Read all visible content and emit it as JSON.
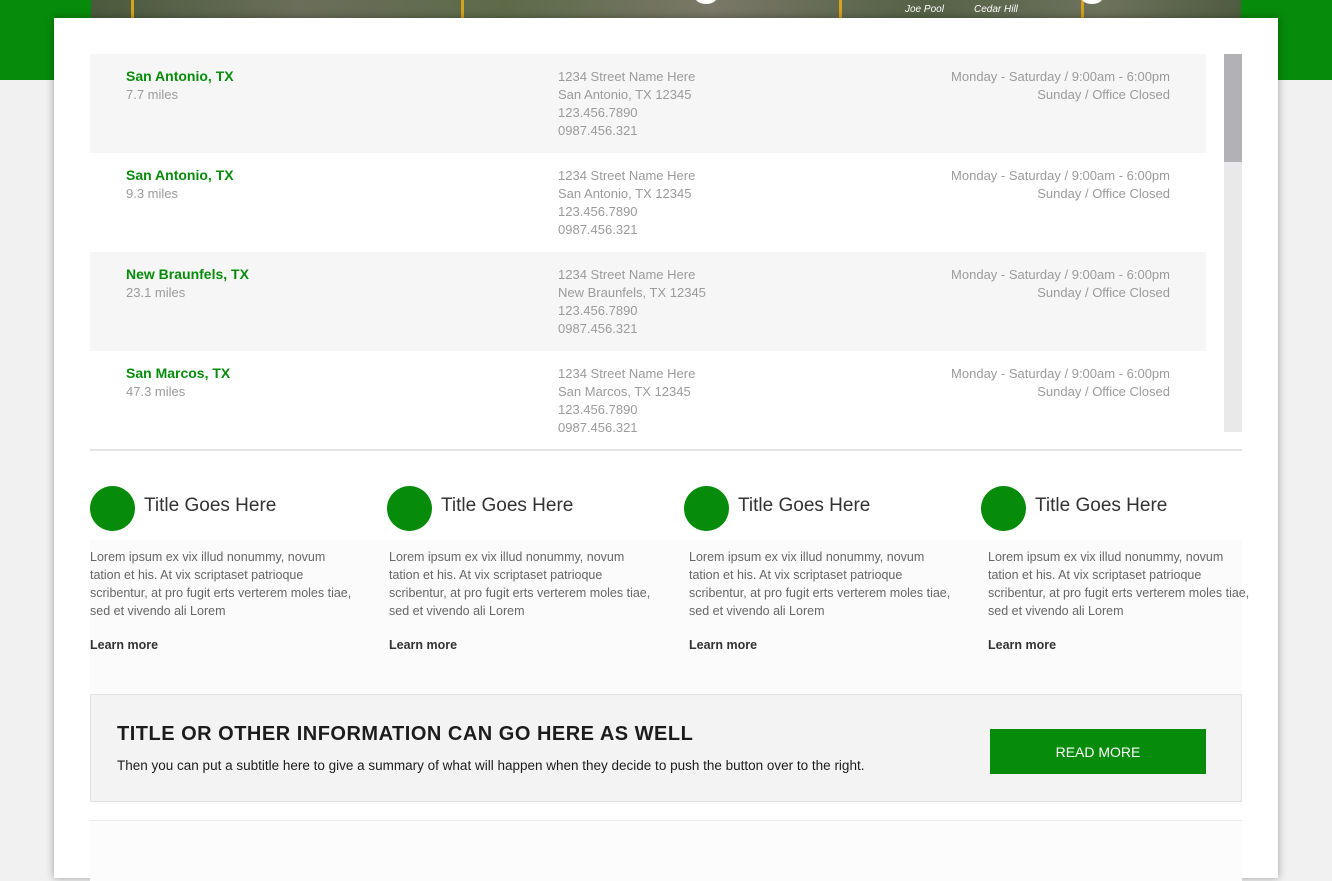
{
  "colors": {
    "brand_green": "#068c0a",
    "muted_text": "#9b9b9b",
    "dark_text": "#1c1c1c",
    "row_shade": "#f6f6f6"
  },
  "map": {
    "labels": [
      "Joe Pool",
      "Cedar Hill"
    ]
  },
  "locations": [
    {
      "city": "San Antonio, TX",
      "distance": "7.7 miles",
      "street": "1234 Street Name Here",
      "city_line": "San Antonio, TX 12345",
      "phone1": "123.456.7890",
      "phone2": "0987.456.321",
      "hours1": "Monday - Saturday / 9:00am - 6:00pm",
      "hours2": "Sunday / Office Closed"
    },
    {
      "city": "San Antonio, TX",
      "distance": "9.3 miles",
      "street": "1234 Street Name Here",
      "city_line": "San Antonio, TX 12345",
      "phone1": "123.456.7890",
      "phone2": "0987.456.321",
      "hours1": "Monday - Saturday / 9:00am - 6:00pm",
      "hours2": "Sunday / Office Closed"
    },
    {
      "city": "New Braunfels, TX",
      "distance": "23.1 miles",
      "street": "1234 Street Name Here",
      "city_line": "New Braunfels, TX 12345",
      "phone1": "123.456.7890",
      "phone2": "0987.456.321",
      "hours1": "Monday - Saturday / 9:00am - 6:00pm",
      "hours2": "Sunday / Office Closed"
    },
    {
      "city": "San Marcos, TX",
      "distance": "47.3 miles",
      "street": "1234 Street Name Here",
      "city_line": "San Marcos, TX 12345",
      "phone1": "123.456.7890",
      "phone2": "0987.456.321",
      "hours1": "Monday - Saturday / 9:00am - 6:00pm",
      "hours2": "Sunday / Office Closed"
    }
  ],
  "features": [
    {
      "title": "Title Goes Here",
      "text": "Lorem ipsum ex vix illud nonummy, novum tation et his. At vix scriptaset patrioque scribentur, at pro fugit erts verterem moles tiae, sed et vivendo ali Lorem",
      "link": "Learn more"
    },
    {
      "title": "Title Goes Here",
      "text": "Lorem ipsum ex vix illud nonummy, novum tation et his. At vix scriptaset patrioque scribentur, at pro fugit erts verterem moles tiae, sed et vivendo ali Lorem",
      "link": "Learn more"
    },
    {
      "title": "Title Goes Here",
      "text": "Lorem ipsum ex vix illud nonummy, novum tation et his. At vix scriptaset patrioque scribentur, at pro fugit erts verterem moles tiae, sed et vivendo ali Lorem",
      "link": "Learn more"
    },
    {
      "title": "Title Goes Here",
      "text": "Lorem ipsum ex vix illud nonummy, novum tation et his. At vix scriptaset patrioque scribentur, at pro fugit erts verterem moles tiae, sed et vivendo ali Lorem",
      "link": "Learn more"
    }
  ],
  "cta": {
    "title": "TITLE OR OTHER INFORMATION CAN GO HERE AS WELL",
    "subtitle": "Then you can put a subtitle here to give a summary of what will happen when they decide to push the button over to the right.",
    "button": "READ MORE"
  }
}
